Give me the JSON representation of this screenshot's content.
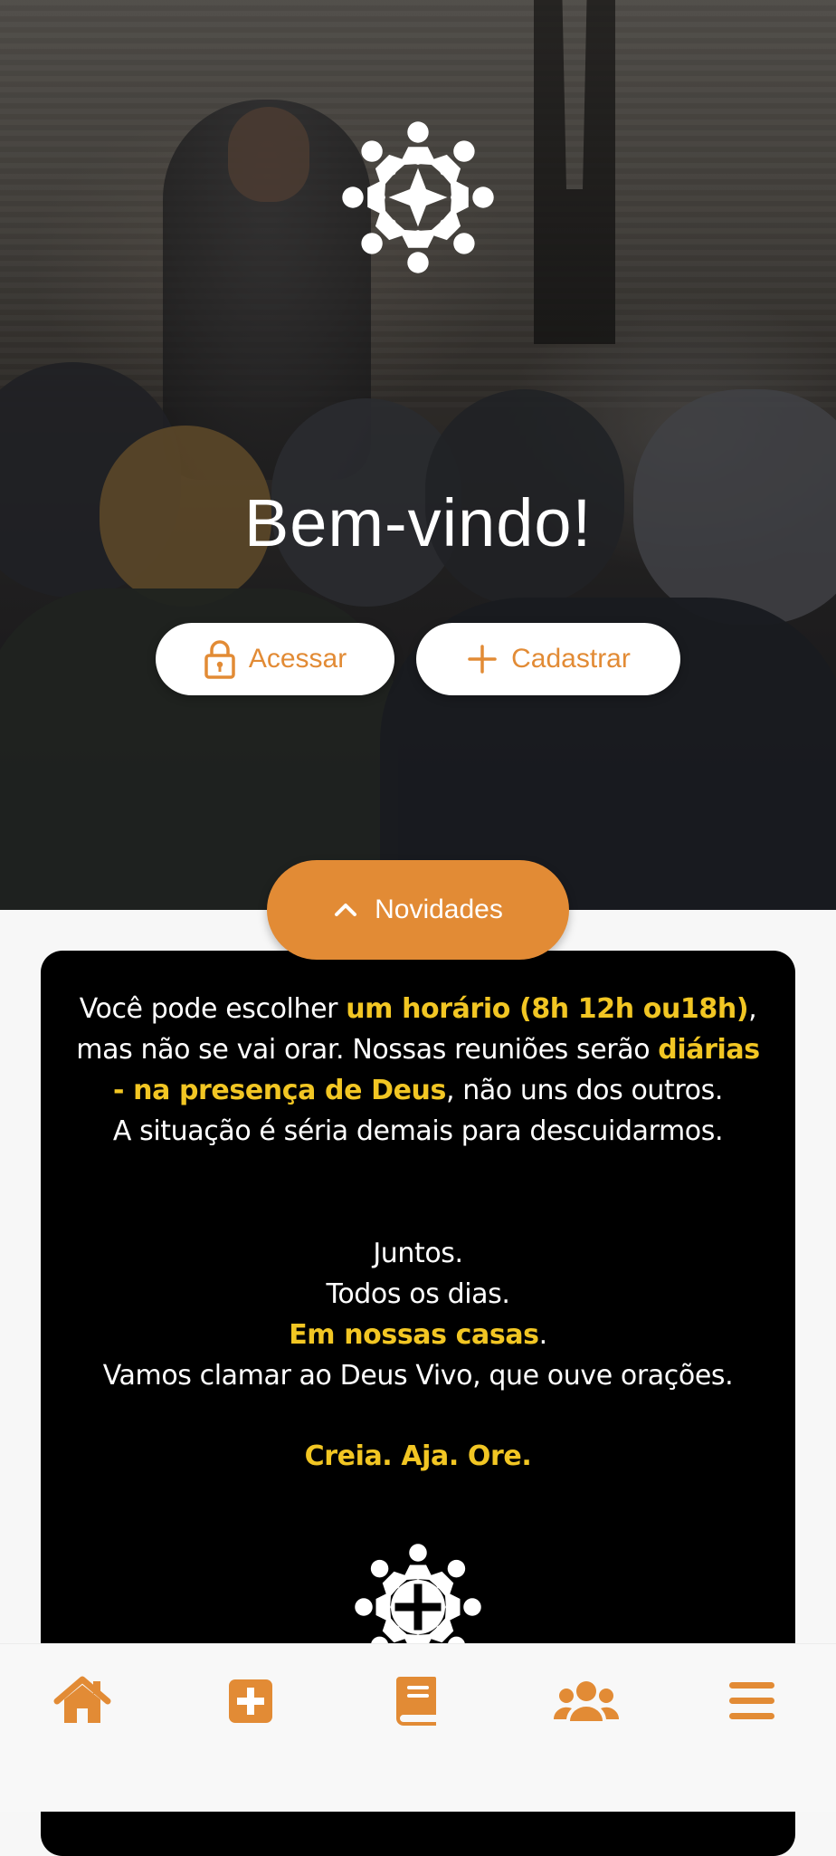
{
  "hero": {
    "welcome_text": "Bem-vindo!",
    "access_label": "Acessar",
    "register_label": "Cadastrar"
  },
  "news": {
    "toggle_label": "Novidades",
    "p1_a": "Você pode escolher ",
    "p1_hl": "um horário (8h 12h ou18h)",
    "p1_b": ",",
    "p2_a": "mas não se vai orar. Nossas reuniões  serão ",
    "p2_hl": "diárias",
    "p3_hl": "- na presença de Deus",
    "p3_b": ", não uns dos outros.",
    "p4": "A situação é séria demais para descuidarmos.",
    "l1": "Juntos.",
    "l2": "Todos os dias.",
    "l3_hl": "Em nossas casas",
    "l3_b": ".",
    "l4": "Vamos clamar ao Deus Vivo, que ouve orações.",
    "motto": "Creia. Aja. Ore."
  },
  "nav": {
    "items": [
      {
        "icon": "home-icon"
      },
      {
        "icon": "plus-square-icon"
      },
      {
        "icon": "book-icon"
      },
      {
        "icon": "users-icon"
      },
      {
        "icon": "menu-icon"
      }
    ]
  },
  "colors": {
    "accent": "#e28b35",
    "highlight": "#f2c623",
    "card_bg": "#000000"
  }
}
